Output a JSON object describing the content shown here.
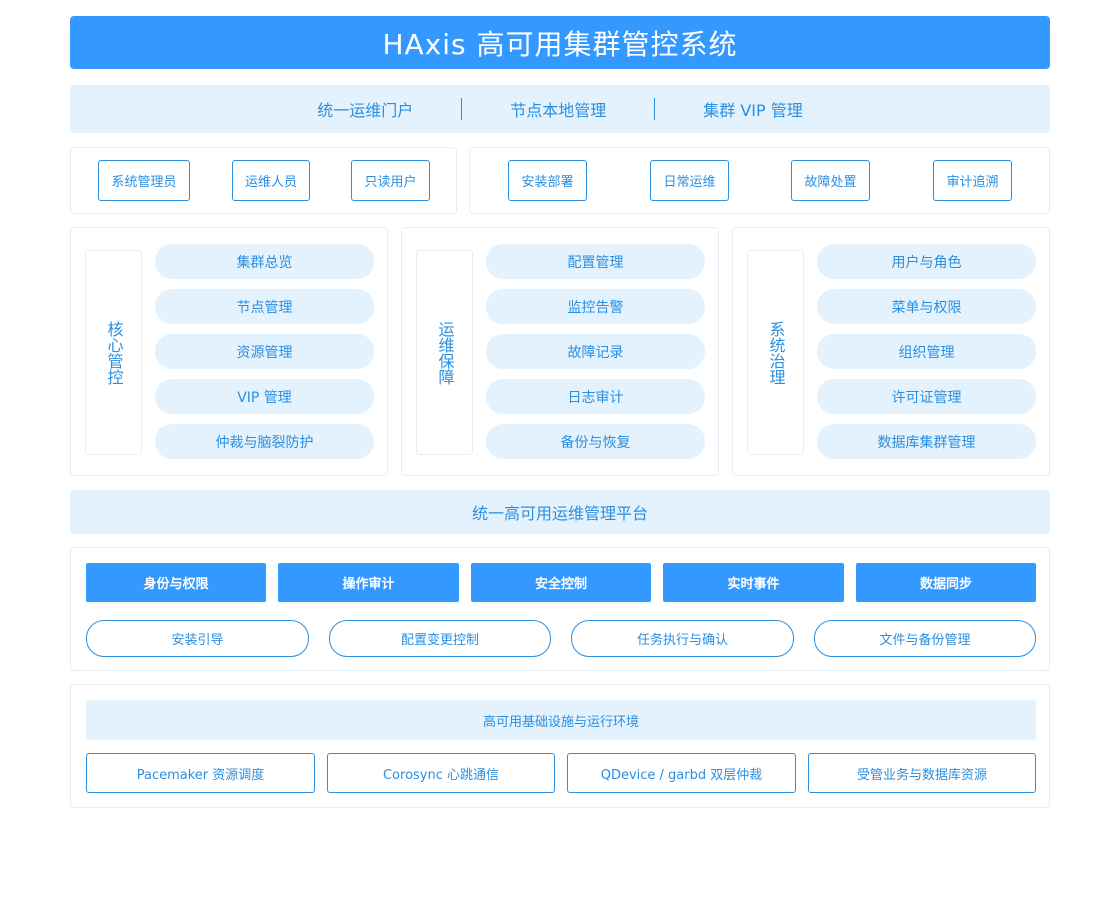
{
  "title": "HAxis 高可用集群管控系统",
  "portals": [
    "统一运维门户",
    "节点本地管理",
    "集群 VIP 管理"
  ],
  "roles": [
    "系统管理员",
    "运维人员",
    "只读用户"
  ],
  "scenarios": [
    "安装部署",
    "日常运维",
    "故障处置",
    "审计追溯"
  ],
  "modules": [
    {
      "label": "核心管控",
      "items": [
        "集群总览",
        "节点管理",
        "资源管理",
        "VIP 管理",
        "仲裁与脑裂防护"
      ]
    },
    {
      "label": "运维保障",
      "items": [
        "配置管理",
        "监控告警",
        "故障记录",
        "日志审计",
        "备份与恢复"
      ]
    },
    {
      "label": "系统治理",
      "items": [
        "用户与角色",
        "菜单与权限",
        "组织管理",
        "许可证管理",
        "数据库集群管理"
      ]
    }
  ],
  "platform": "统一高可用运维管理平台",
  "capabilities": [
    "身份与权限",
    "操作审计",
    "安全控制",
    "实时事件",
    "数据同步"
  ],
  "workflows": [
    "安装引导",
    "配置变更控制",
    "任务执行与确认",
    "文件与备份管理"
  ],
  "infra_title": "高可用基础设施与运行环境",
  "infra": [
    "Pacemaker 资源调度",
    "Corosync 心跳通信",
    "QDevice / garbd 双层仲裁",
    "受管业务与数据库资源"
  ],
  "colors": {
    "primary": "#3399ff",
    "text": "#2b8fe0",
    "light_bg": "#e3f2fd",
    "border": "#e3eef8"
  }
}
